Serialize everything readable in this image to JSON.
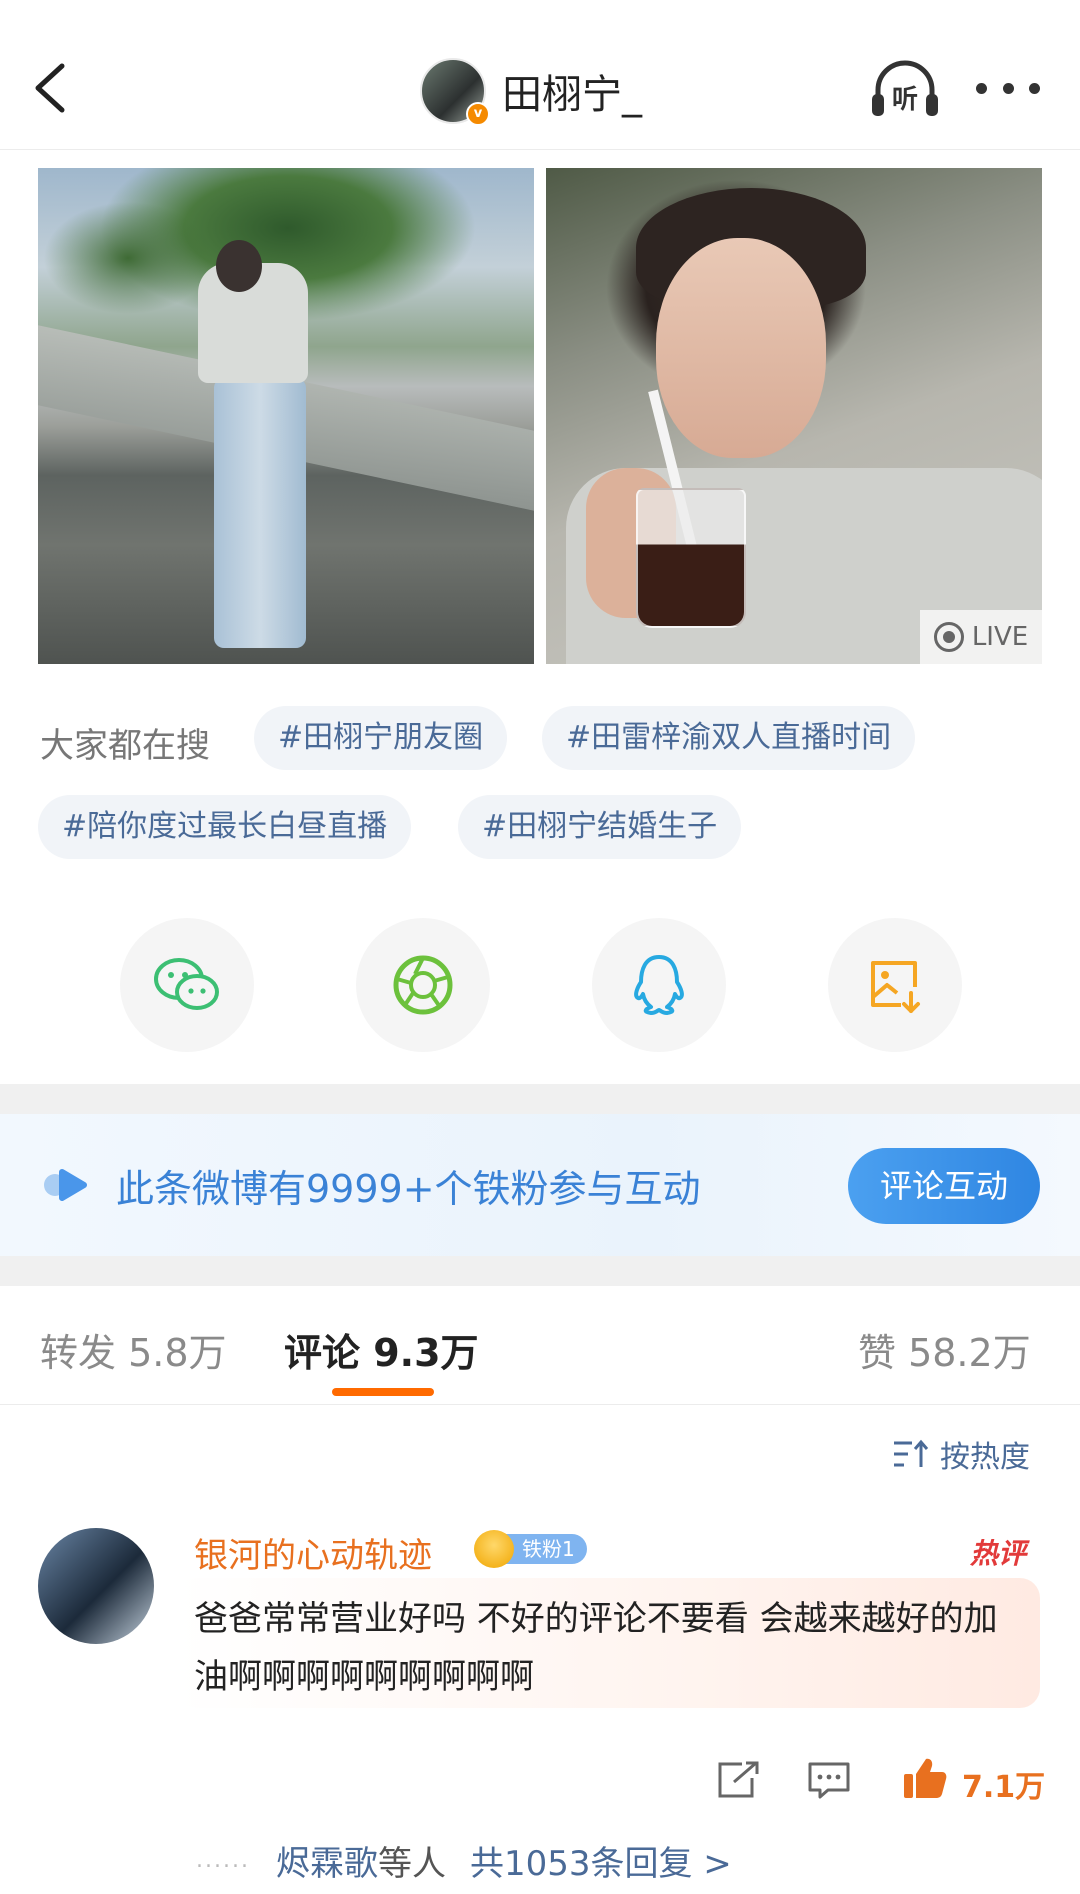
{
  "header": {
    "username": "田栩宁_",
    "listen_label": "听"
  },
  "photos": {
    "live_label": "LIVE"
  },
  "search": {
    "label": "大家都在搜",
    "tags": [
      "#田栩宁朋友圈",
      "#田雷梓渝双人直播时间",
      "#陪你度过最长白昼直播",
      "#田栩宁结婚生子"
    ]
  },
  "share": {
    "icons": [
      "wechat-icon",
      "moments-icon",
      "qq-icon",
      "save-image-icon"
    ]
  },
  "fans_banner": {
    "text": "此条微博有9999+个铁粉参与互动",
    "button": "评论互动"
  },
  "tabs": {
    "repost": "转发 5.8万",
    "comment": "评论 9.3万",
    "like": "赞 58.2万"
  },
  "sort": {
    "label": "按热度"
  },
  "comment": {
    "name": "银河的心动轨迹",
    "fan_badge": "铁粉1",
    "hot_label": "热评",
    "text": "爸爸常常营业好吗 不好的评论不要看 会越来越好的加油啊啊啊啊啊啊啊啊啊",
    "like_count": "7.1万",
    "reply_dots": "......",
    "reply_name": "烬霖歌",
    "reply_mid": "等人",
    "reply_total": "共1053条回复 >"
  },
  "colors": {
    "accent_orange": "#ff6a00",
    "link_blue": "#4a6a97",
    "banner_blue": "#3a82d6",
    "hot_red": "#e23a3a"
  }
}
